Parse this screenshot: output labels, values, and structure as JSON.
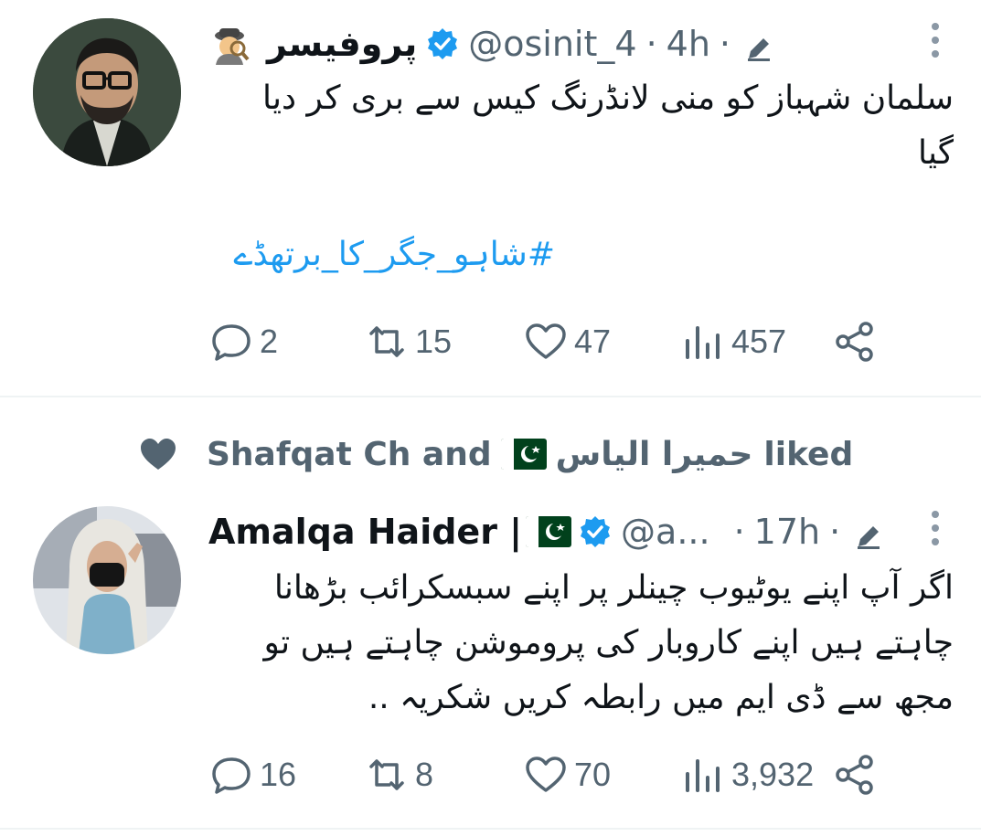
{
  "tweets": [
    {
      "author_name": "پروفیسر",
      "handle": "@osinit_4",
      "separator": "·",
      "time": "4h",
      "text_line1": "سلمان شہباز کو منی لانڈرنگ کیس سے بری کر دیا",
      "text_line2": "گیا",
      "hashtag": "#شاہو_جگر_کا_برتھڈے",
      "replies": "2",
      "retweets": "15",
      "likes": "47",
      "views": "457",
      "avatar_icon": "professor-avatar",
      "emoji_icon": "detective-icon"
    },
    {
      "social_context_names": "Shafqat Ch and",
      "social_context_urdu": "حمیرا الیاس",
      "social_context_liked": "liked",
      "author_name": "Amalqa Haider |",
      "handle": "@a...",
      "separator": "·",
      "time": "17h",
      "text_line1": "اگر آپ اپنے یوٹیوب چینلر پر اپنے سبسکرائب بڑھانا",
      "text_line2": "چاہتے ہیں اپنے کاروبار کی پروموشن چاہتے ہیں تو",
      "text_line3": "مجھ سے ڈی ایم میں رابطہ کریں شکریہ ..",
      "replies": "16",
      "retweets": "8",
      "likes": "70",
      "views": "3,932",
      "avatar_icon": "woman-avatar"
    }
  ],
  "colors": {
    "accent": "#1d9bf0",
    "muted": "#536471",
    "text": "#0f1419",
    "divider": "#eff3f4"
  }
}
